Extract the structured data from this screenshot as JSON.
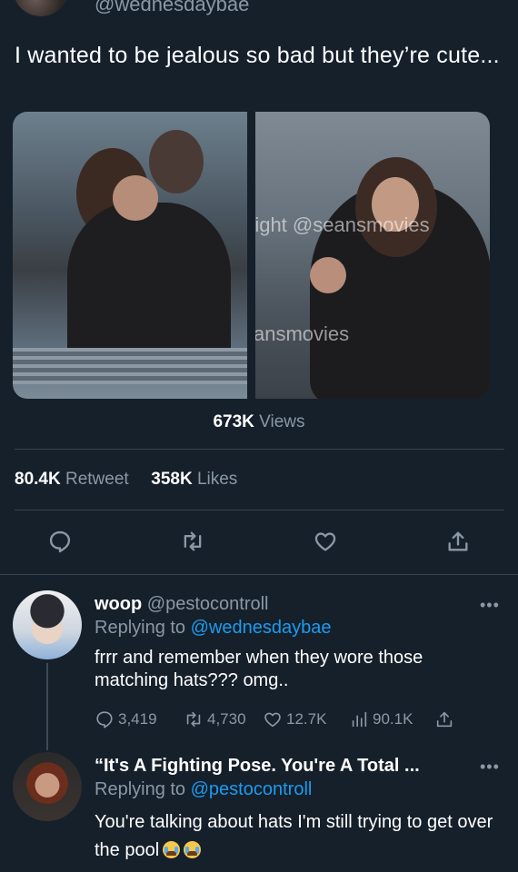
{
  "tweet": {
    "handle": "@wednesdaybae",
    "text": "I wanted to be jealous so bad but they’re cute...",
    "watermarks": [
      "right @seansmovies",
      "ansmovies"
    ],
    "views_count": "673K",
    "views_label": "Views",
    "retweet_count": "80.4K",
    "retweet_label": "Retweet",
    "likes_count": "358K",
    "likes_label": "Likes"
  },
  "actions": {
    "icons": [
      "reply-icon",
      "retweet-icon",
      "like-icon",
      "share-icon"
    ]
  },
  "replies": [
    {
      "name": "woop",
      "handle": "@pestocontroll",
      "replying_prefix": "Replying to",
      "replying_to": "@wednesdaybae",
      "text": "frrr and remember when they wore those matching hats??? omg..",
      "stats": {
        "replies": "3,419",
        "retweets": "4,730",
        "likes": "12.7K",
        "views": "90.1K"
      },
      "more": "•••"
    },
    {
      "name": "“It's A Fighting Pose. You're A Total ...",
      "replying_prefix": "Replying to",
      "replying_to": "@pestocontroll",
      "text": "You're talking about hats I'm still trying to get over the pool",
      "emojis": [
        "loudly-crying-face",
        "loudly-crying-face"
      ],
      "more": "•••"
    }
  ],
  "colors": {
    "background": "#15202b",
    "muted": "#8b98a5",
    "link": "#1d9bf0",
    "divider": "#38444d"
  }
}
